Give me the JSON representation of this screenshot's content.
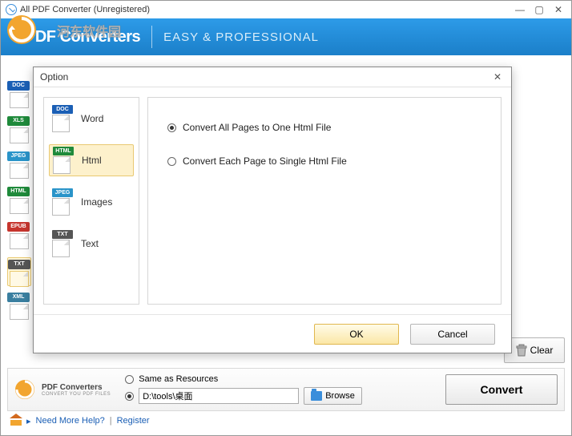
{
  "window": {
    "title": "All PDF Converter (Unregistered)"
  },
  "banner": {
    "brand_prefix": "PDF ",
    "brand": "Converters",
    "tagline": "EASY & PROFESSIONAL",
    "watermark": "河东软件园"
  },
  "sidebar": {
    "items": [
      {
        "badge": "DOC"
      },
      {
        "badge": "XLS"
      },
      {
        "badge": "JPEG"
      },
      {
        "badge": "HTML"
      },
      {
        "badge": "EPUB"
      },
      {
        "badge": "TXT"
      },
      {
        "badge": "XML"
      }
    ]
  },
  "clear_label": "Clear",
  "output": {
    "brand": "PDF Converters",
    "brand_sub": "CONVERT YOU PDF FILES",
    "same_label": "Same as Resources",
    "path": "D:\\tools\\桌面",
    "browse_label": "Browse",
    "convert_label": "Convert"
  },
  "help": {
    "need": "Need More Help?",
    "register": "Register"
  },
  "dialog": {
    "title": "Option",
    "tabs": [
      {
        "badge": "DOC",
        "label": "Word",
        "color": "c-doc"
      },
      {
        "badge": "HTML",
        "label": "Html",
        "color": "c-html"
      },
      {
        "badge": "JPEG",
        "label": "Images",
        "color": "c-jpeg"
      },
      {
        "badge": "TXT",
        "label": "Text",
        "color": "c-txt"
      }
    ],
    "selected_tab": 1,
    "options": [
      {
        "label": "Convert All Pages to One Html File",
        "selected": true
      },
      {
        "label": "Convert Each Page to Single Html File",
        "selected": false
      }
    ],
    "ok_label": "OK",
    "cancel_label": "Cancel"
  }
}
